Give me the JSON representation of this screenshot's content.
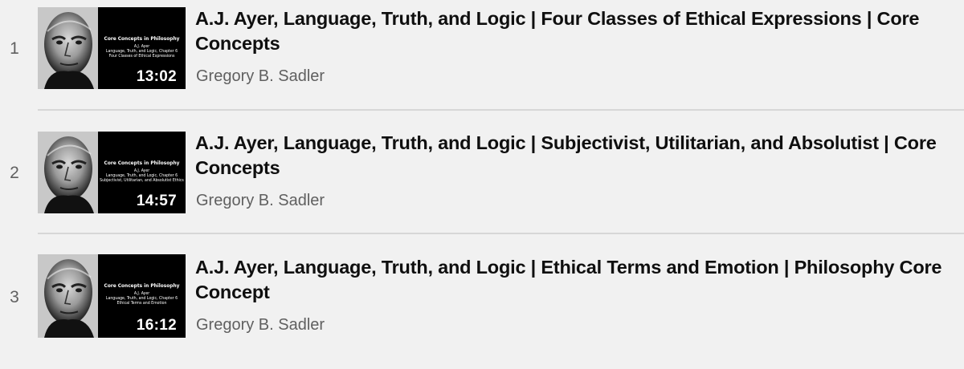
{
  "playlist": {
    "items": [
      {
        "index": "1",
        "title": "A.J. Ayer, Language, Truth, and Logic | Four Classes of Ethical Expressions | Core Concepts",
        "channel": "Gregory B. Sadler",
        "duration": "13:02",
        "thumbnail": {
          "series": "Core Concepts in Philosophy",
          "lines": [
            "A.J. Ayer",
            "Language, Truth, and Logic, Chapter 6",
            "Four Classes of Ethical Expressions"
          ]
        }
      },
      {
        "index": "2",
        "title": "A.J. Ayer, Language, Truth, and Logic | Subjectivist, Utilitarian, and Absolutist | Core Concepts",
        "channel": "Gregory B. Sadler",
        "duration": "14:57",
        "thumbnail": {
          "series": "Core Concepts in Philosophy",
          "lines": [
            "A.J. Ayer",
            "Language, Truth, and Logic, Chapter 6",
            "Subjectivist, Utilitarian, and Absolutist Ethics"
          ]
        }
      },
      {
        "index": "3",
        "title": "A.J. Ayer, Language, Truth, and Logic | Ethical Terms and Emotion | Philosophy Core Concept",
        "channel": "Gregory B. Sadler",
        "duration": "16:12",
        "thumbnail": {
          "series": "Core Concepts in Philosophy",
          "lines": [
            "A.J. Ayer",
            "Language, Truth, and Logic, Chapter 6",
            "Ethical Terms and Emotion"
          ]
        }
      }
    ]
  },
  "colors": {
    "background": "#f1f1f1",
    "title": "#0f0f0f",
    "secondary_text": "#606060",
    "divider": "#d7d7d7",
    "thumbnail_bg": "#000000"
  },
  "icons": {
    "thumbnail_photo": "portrait-photo"
  }
}
